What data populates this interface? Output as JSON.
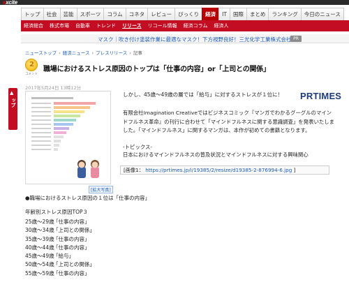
{
  "brand": {
    "logo_prefix": "e",
    "logo_rest": "xcite"
  },
  "main_nav": [
    "トップ",
    "社会",
    "芸能",
    "スポーツ",
    "コラム",
    "コネタ",
    "レビュー",
    "びっくり",
    "経済",
    "IT",
    "国際",
    "まとめ",
    "ランキング",
    "今日のニュース"
  ],
  "main_nav_active": "経済",
  "sub_nav": [
    "経済総合",
    "株式市場",
    "自動車",
    "トレンド",
    "リリース",
    "リコール情報",
    "経済コラム",
    "経済人"
  ],
  "sub_nav_active": "リリース",
  "ad": {
    "text": "マスク｜吹き付け塗装作業に最適なマスク！下方視野良好！三光化学工業株式会社",
    "badge": "PR"
  },
  "breadcrumb": [
    "ニューストップ",
    "経済ニュース",
    "プレスリリース",
    "記事"
  ],
  "category": {
    "label": "コメント"
  },
  "article": {
    "title": "職場におけるストレス原因のトップは「仕事の内容」or「上司との関係」",
    "date": "2017年5月24日 13時12分",
    "lead": "しかし、45歳～49歳の層では「給与」に対するストレスが１位に！",
    "source_logo": "PRTIMES",
    "paragraph": "有限会社Imagination Creativeではビジネスコミック『マンガでわかるグーグルのマインドフルネス革命』の刊行に合わせて「マインドフルネスに関する意識調査」を発表いたしました。「マインドフルネス」に関するマンガは、本作が初めての書籍となります。",
    "topics_head": "-トピックス-",
    "topic_item": "日本におけるマインドフルネスの普及状況とマインドフルネスに対する興味関心",
    "image_label": "[画像1：",
    "image_url": "https://prtimes.jp/i/19385/2/resize/d19385-2-876994-6.jpg",
    "image_close": "]",
    "zoom_label": "[拡大写真]",
    "point": "●職場におけるストレス原因の１位は「仕事の内容」",
    "top3_head": "年齢別ストレス原因TOP３",
    "rows": [
      {
        "age": "25歳～29歳",
        "cause": "「仕事の内容」"
      },
      {
        "age": "30歳～34歳",
        "cause": "「上司との関係」"
      },
      {
        "age": "35歳～39歳",
        "cause": "「仕事の内容」"
      },
      {
        "age": "40歳～44歳",
        "cause": "「仕事の内容」"
      },
      {
        "age": "45歳～49歳",
        "cause": "「給与」"
      },
      {
        "age": "50歳～54歳",
        "cause": "「上司との関係」"
      },
      {
        "age": "55歳～59歳",
        "cause": "「仕事の内容」"
      }
    ]
  },
  "sidebar": {
    "label": "エキサイトトップ"
  },
  "colors": {
    "brand_red": "#c30d23",
    "link_blue": "#1a5bb8"
  }
}
